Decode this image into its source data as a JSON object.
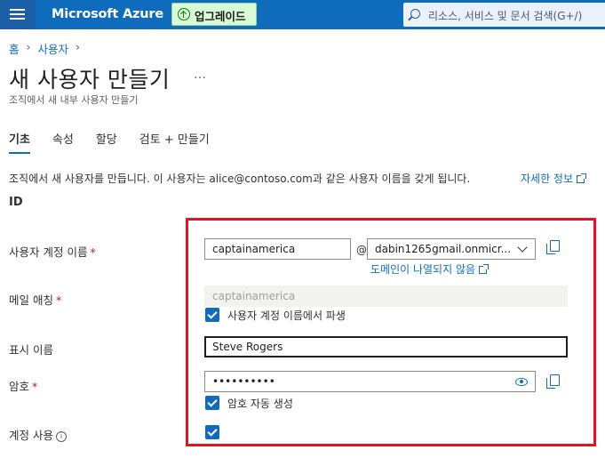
{
  "topbar": {
    "brand": "Microsoft Azure",
    "upgrade_label": "업그레이드",
    "search_placeholder": "리소스, 서비스 및 문서 검색(G+/)"
  },
  "breadcrumb": {
    "items": [
      "홈",
      "사용자"
    ]
  },
  "page": {
    "title": "새 사용자 만들기",
    "more": "…",
    "subtitle": "조직에서 새 내부 사용자 만들기"
  },
  "tabs": [
    {
      "label": "기초",
      "active": true
    },
    {
      "label": "속성"
    },
    {
      "label": "할당"
    },
    {
      "label": "검토 + 만들기"
    }
  ],
  "intro": {
    "text": "조직에서 새 사용자를 만듭니다. 이 사용자는 alice@contoso.com과 같은 사용자 이름을 갖게 됩니다.",
    "link": "자세한 정보"
  },
  "section": {
    "title": "ID"
  },
  "form": {
    "upn_label": "사용자 계정 이름",
    "upn_value": "captainamerica",
    "at": "@",
    "domain_value": "dabin1265gmail.onmicr...",
    "domain_help_link": "도메인이 나열되지 않음",
    "mail_nickname_label": "메일 애칭",
    "mail_nickname_value": "captainamerica",
    "derive_label": "사용자 계정 이름에서 파생",
    "display_name_label": "표시 이름",
    "display_name_value": "Steve Rogers",
    "password_label": "암호",
    "password_value": "••••••••••",
    "auto_password_label": "암호 자동 생성",
    "account_enabled_label": "계정 사용",
    "required_marker": "*",
    "info_glyph": "i"
  },
  "colors": {
    "brand": "#0f6cbd",
    "highlight": "#e81123",
    "upgrade_bg": "#d8fbd5"
  }
}
